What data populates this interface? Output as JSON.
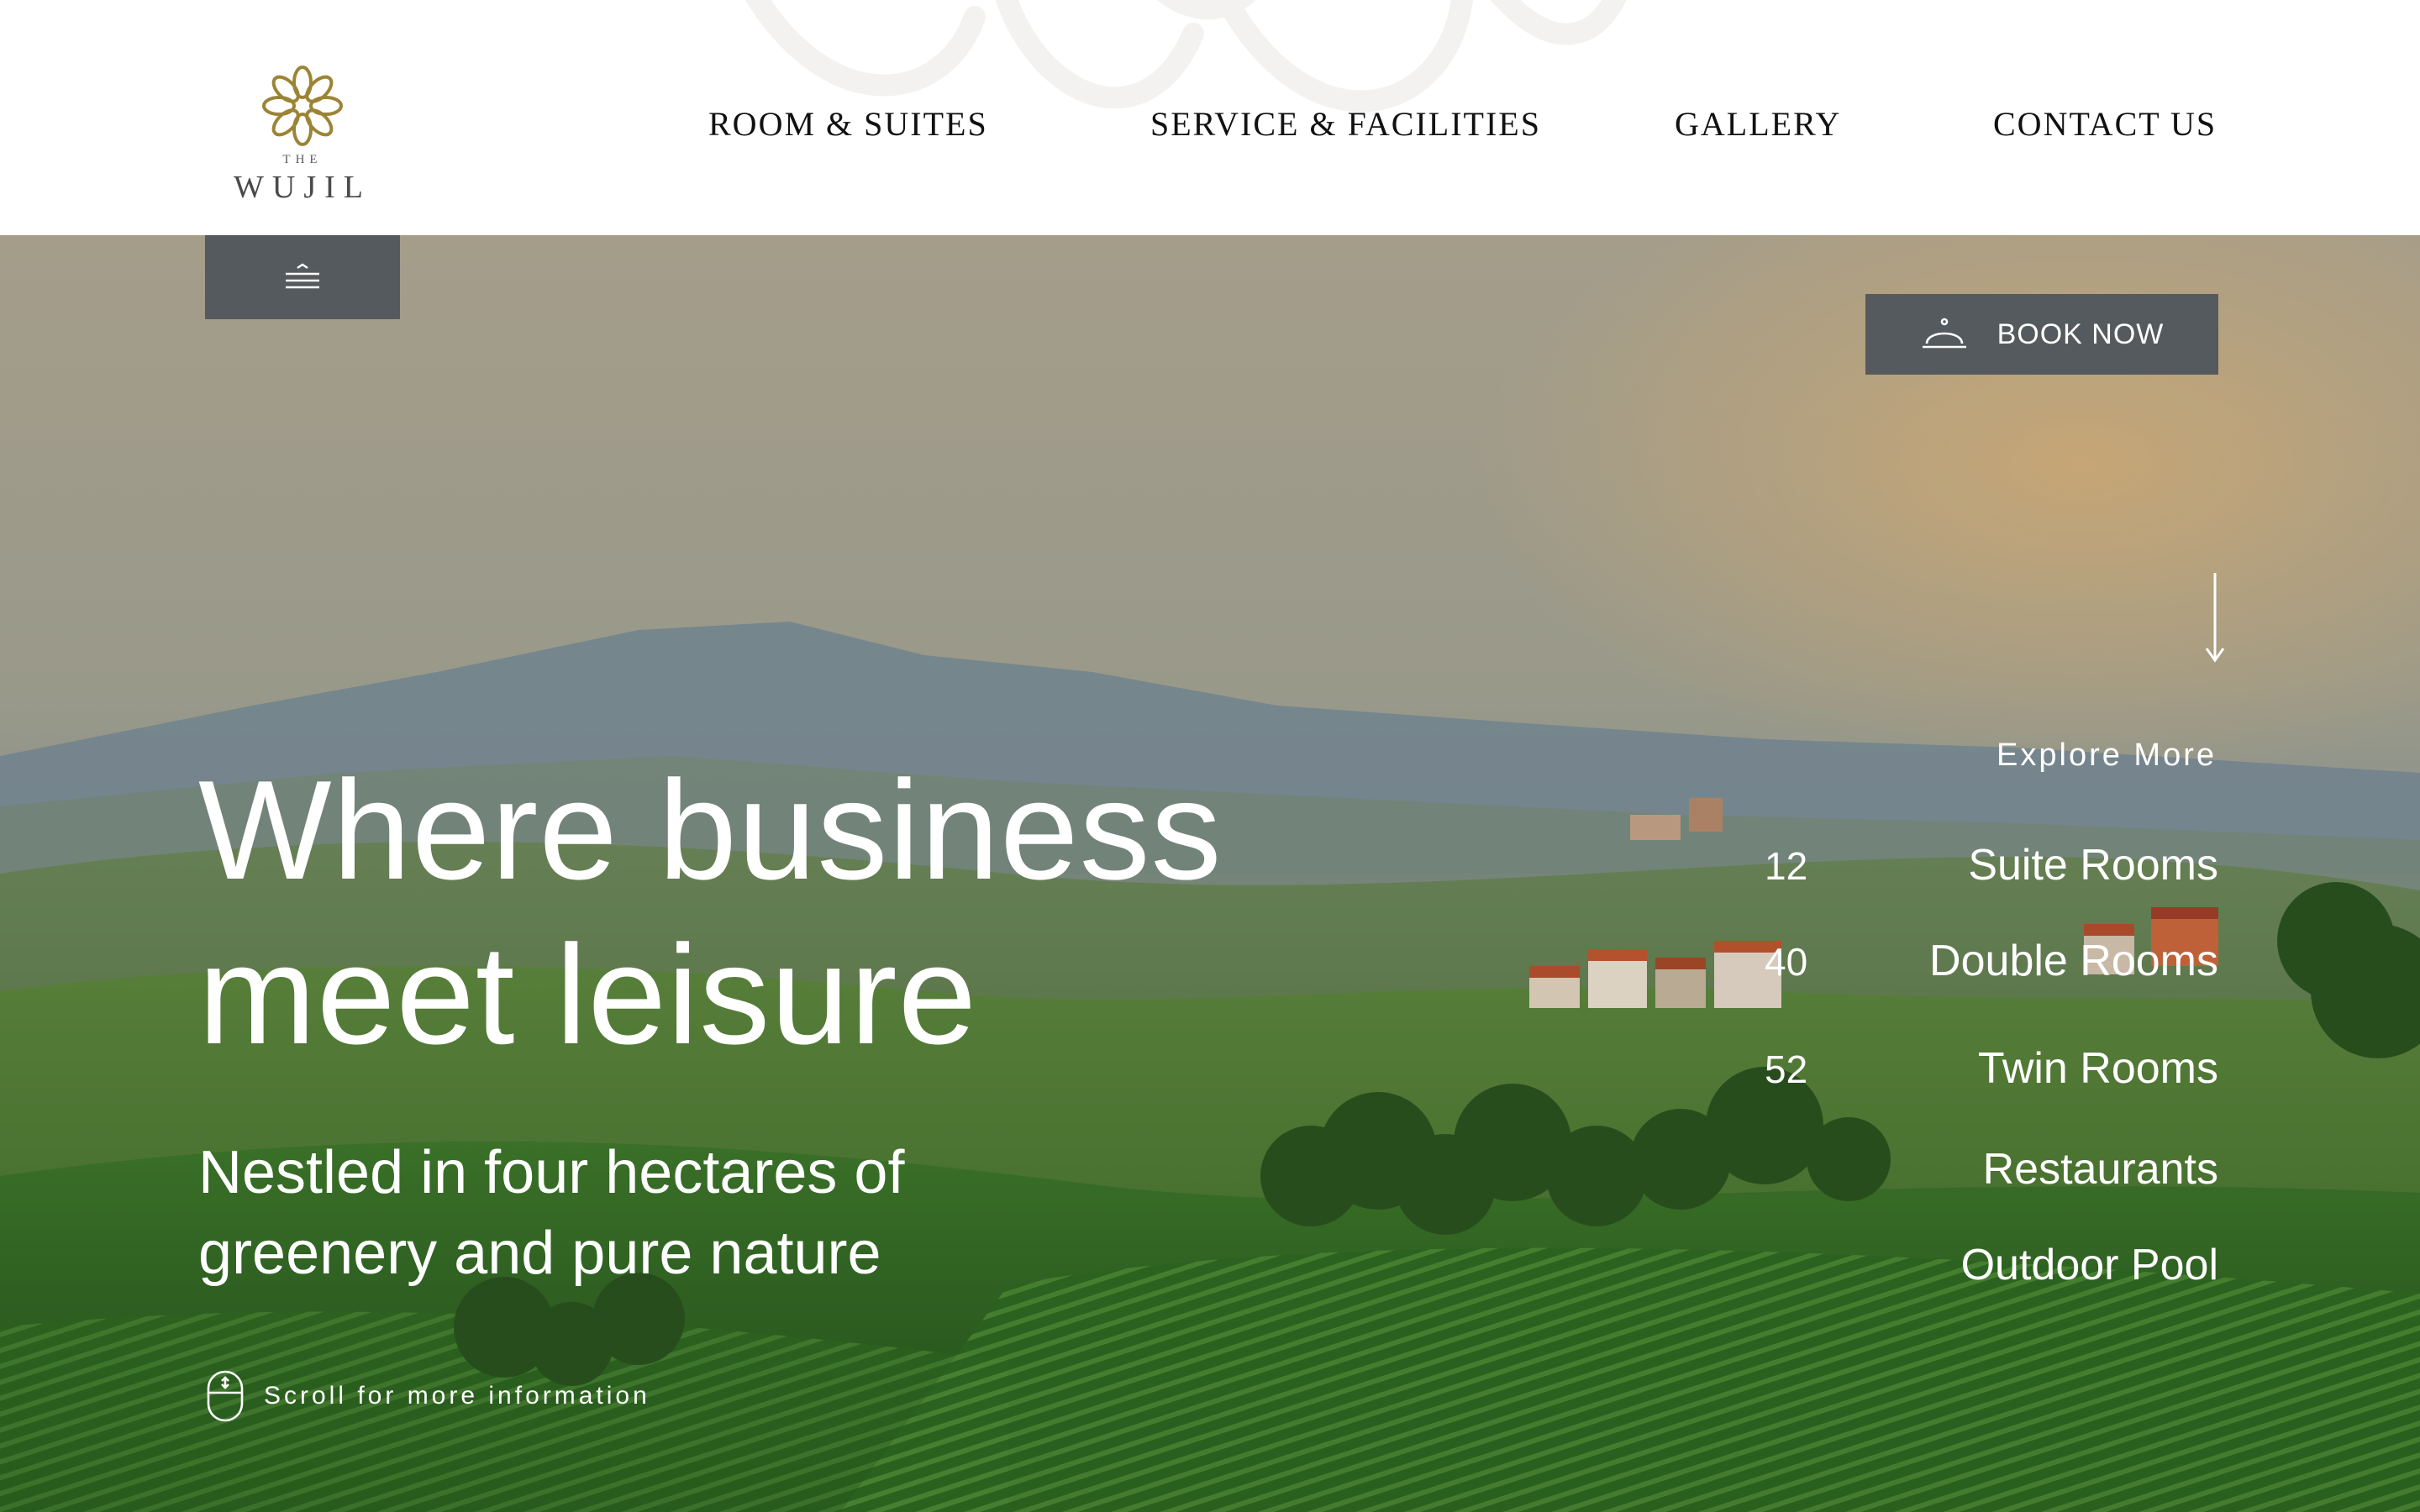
{
  "brand": {
    "logo_small_text": "THE",
    "logo_name": "WUJIL",
    "accent_color": "#9b8435"
  },
  "nav": {
    "items": [
      {
        "label": "ROOM & SUITES"
      },
      {
        "label": "SERVICE & FACILITIES"
      },
      {
        "label": "GALLERY"
      },
      {
        "label": "CONTACT US"
      }
    ]
  },
  "menu_button": {
    "icon": "hamburger-menu-icon"
  },
  "book": {
    "label": "BOOK NOW",
    "icon": "service-bell-icon"
  },
  "explore": {
    "label": "Explore More",
    "icon": "arrow-down-icon"
  },
  "stats": [
    {
      "number": "12",
      "label": "Suite Rooms"
    },
    {
      "number": "40",
      "label": "Double Rooms"
    },
    {
      "number": "52",
      "label": "Twin Rooms"
    },
    {
      "number": "",
      "label": "Restaurants"
    },
    {
      "number": "",
      "label": "Outdoor Pool"
    }
  ],
  "hero": {
    "headline_line1": "Where business",
    "headline_line2": "meet leisure",
    "subline_line1": "Nestled in four hectares of",
    "subline_line2": "greenery and pure nature"
  },
  "scroll_hint": {
    "label": "Scroll for more information",
    "icon": "mouse-scroll-icon"
  },
  "colors": {
    "button_bg": "#555a5e",
    "text_light": "#ffffff",
    "nav_text": "#111111"
  }
}
